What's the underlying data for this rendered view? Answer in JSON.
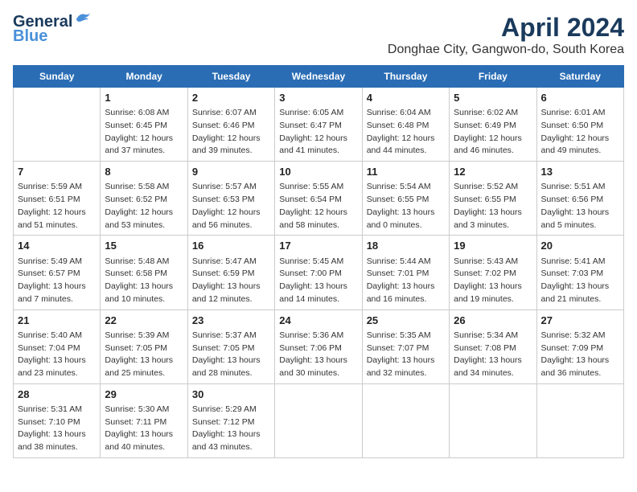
{
  "logo": {
    "line1": "General",
    "line2": "Blue"
  },
  "title": "April 2024",
  "location": "Donghae City, Gangwon-do, South Korea",
  "days_header": [
    "Sunday",
    "Monday",
    "Tuesday",
    "Wednesday",
    "Thursday",
    "Friday",
    "Saturday"
  ],
  "weeks": [
    [
      {
        "day": "",
        "info": ""
      },
      {
        "day": "1",
        "info": "Sunrise: 6:08 AM\nSunset: 6:45 PM\nDaylight: 12 hours\nand 37 minutes."
      },
      {
        "day": "2",
        "info": "Sunrise: 6:07 AM\nSunset: 6:46 PM\nDaylight: 12 hours\nand 39 minutes."
      },
      {
        "day": "3",
        "info": "Sunrise: 6:05 AM\nSunset: 6:47 PM\nDaylight: 12 hours\nand 41 minutes."
      },
      {
        "day": "4",
        "info": "Sunrise: 6:04 AM\nSunset: 6:48 PM\nDaylight: 12 hours\nand 44 minutes."
      },
      {
        "day": "5",
        "info": "Sunrise: 6:02 AM\nSunset: 6:49 PM\nDaylight: 12 hours\nand 46 minutes."
      },
      {
        "day": "6",
        "info": "Sunrise: 6:01 AM\nSunset: 6:50 PM\nDaylight: 12 hours\nand 49 minutes."
      }
    ],
    [
      {
        "day": "7",
        "info": "Sunrise: 5:59 AM\nSunset: 6:51 PM\nDaylight: 12 hours\nand 51 minutes."
      },
      {
        "day": "8",
        "info": "Sunrise: 5:58 AM\nSunset: 6:52 PM\nDaylight: 12 hours\nand 53 minutes."
      },
      {
        "day": "9",
        "info": "Sunrise: 5:57 AM\nSunset: 6:53 PM\nDaylight: 12 hours\nand 56 minutes."
      },
      {
        "day": "10",
        "info": "Sunrise: 5:55 AM\nSunset: 6:54 PM\nDaylight: 12 hours\nand 58 minutes."
      },
      {
        "day": "11",
        "info": "Sunrise: 5:54 AM\nSunset: 6:55 PM\nDaylight: 13 hours\nand 0 minutes."
      },
      {
        "day": "12",
        "info": "Sunrise: 5:52 AM\nSunset: 6:55 PM\nDaylight: 13 hours\nand 3 minutes."
      },
      {
        "day": "13",
        "info": "Sunrise: 5:51 AM\nSunset: 6:56 PM\nDaylight: 13 hours\nand 5 minutes."
      }
    ],
    [
      {
        "day": "14",
        "info": "Sunrise: 5:49 AM\nSunset: 6:57 PM\nDaylight: 13 hours\nand 7 minutes."
      },
      {
        "day": "15",
        "info": "Sunrise: 5:48 AM\nSunset: 6:58 PM\nDaylight: 13 hours\nand 10 minutes."
      },
      {
        "day": "16",
        "info": "Sunrise: 5:47 AM\nSunset: 6:59 PM\nDaylight: 13 hours\nand 12 minutes."
      },
      {
        "day": "17",
        "info": "Sunrise: 5:45 AM\nSunset: 7:00 PM\nDaylight: 13 hours\nand 14 minutes."
      },
      {
        "day": "18",
        "info": "Sunrise: 5:44 AM\nSunset: 7:01 PM\nDaylight: 13 hours\nand 16 minutes."
      },
      {
        "day": "19",
        "info": "Sunrise: 5:43 AM\nSunset: 7:02 PM\nDaylight: 13 hours\nand 19 minutes."
      },
      {
        "day": "20",
        "info": "Sunrise: 5:41 AM\nSunset: 7:03 PM\nDaylight: 13 hours\nand 21 minutes."
      }
    ],
    [
      {
        "day": "21",
        "info": "Sunrise: 5:40 AM\nSunset: 7:04 PM\nDaylight: 13 hours\nand 23 minutes."
      },
      {
        "day": "22",
        "info": "Sunrise: 5:39 AM\nSunset: 7:05 PM\nDaylight: 13 hours\nand 25 minutes."
      },
      {
        "day": "23",
        "info": "Sunrise: 5:37 AM\nSunset: 7:05 PM\nDaylight: 13 hours\nand 28 minutes."
      },
      {
        "day": "24",
        "info": "Sunrise: 5:36 AM\nSunset: 7:06 PM\nDaylight: 13 hours\nand 30 minutes."
      },
      {
        "day": "25",
        "info": "Sunrise: 5:35 AM\nSunset: 7:07 PM\nDaylight: 13 hours\nand 32 minutes."
      },
      {
        "day": "26",
        "info": "Sunrise: 5:34 AM\nSunset: 7:08 PM\nDaylight: 13 hours\nand 34 minutes."
      },
      {
        "day": "27",
        "info": "Sunrise: 5:32 AM\nSunset: 7:09 PM\nDaylight: 13 hours\nand 36 minutes."
      }
    ],
    [
      {
        "day": "28",
        "info": "Sunrise: 5:31 AM\nSunset: 7:10 PM\nDaylight: 13 hours\nand 38 minutes."
      },
      {
        "day": "29",
        "info": "Sunrise: 5:30 AM\nSunset: 7:11 PM\nDaylight: 13 hours\nand 40 minutes."
      },
      {
        "day": "30",
        "info": "Sunrise: 5:29 AM\nSunset: 7:12 PM\nDaylight: 13 hours\nand 43 minutes."
      },
      {
        "day": "",
        "info": ""
      },
      {
        "day": "",
        "info": ""
      },
      {
        "day": "",
        "info": ""
      },
      {
        "day": "",
        "info": ""
      }
    ]
  ]
}
